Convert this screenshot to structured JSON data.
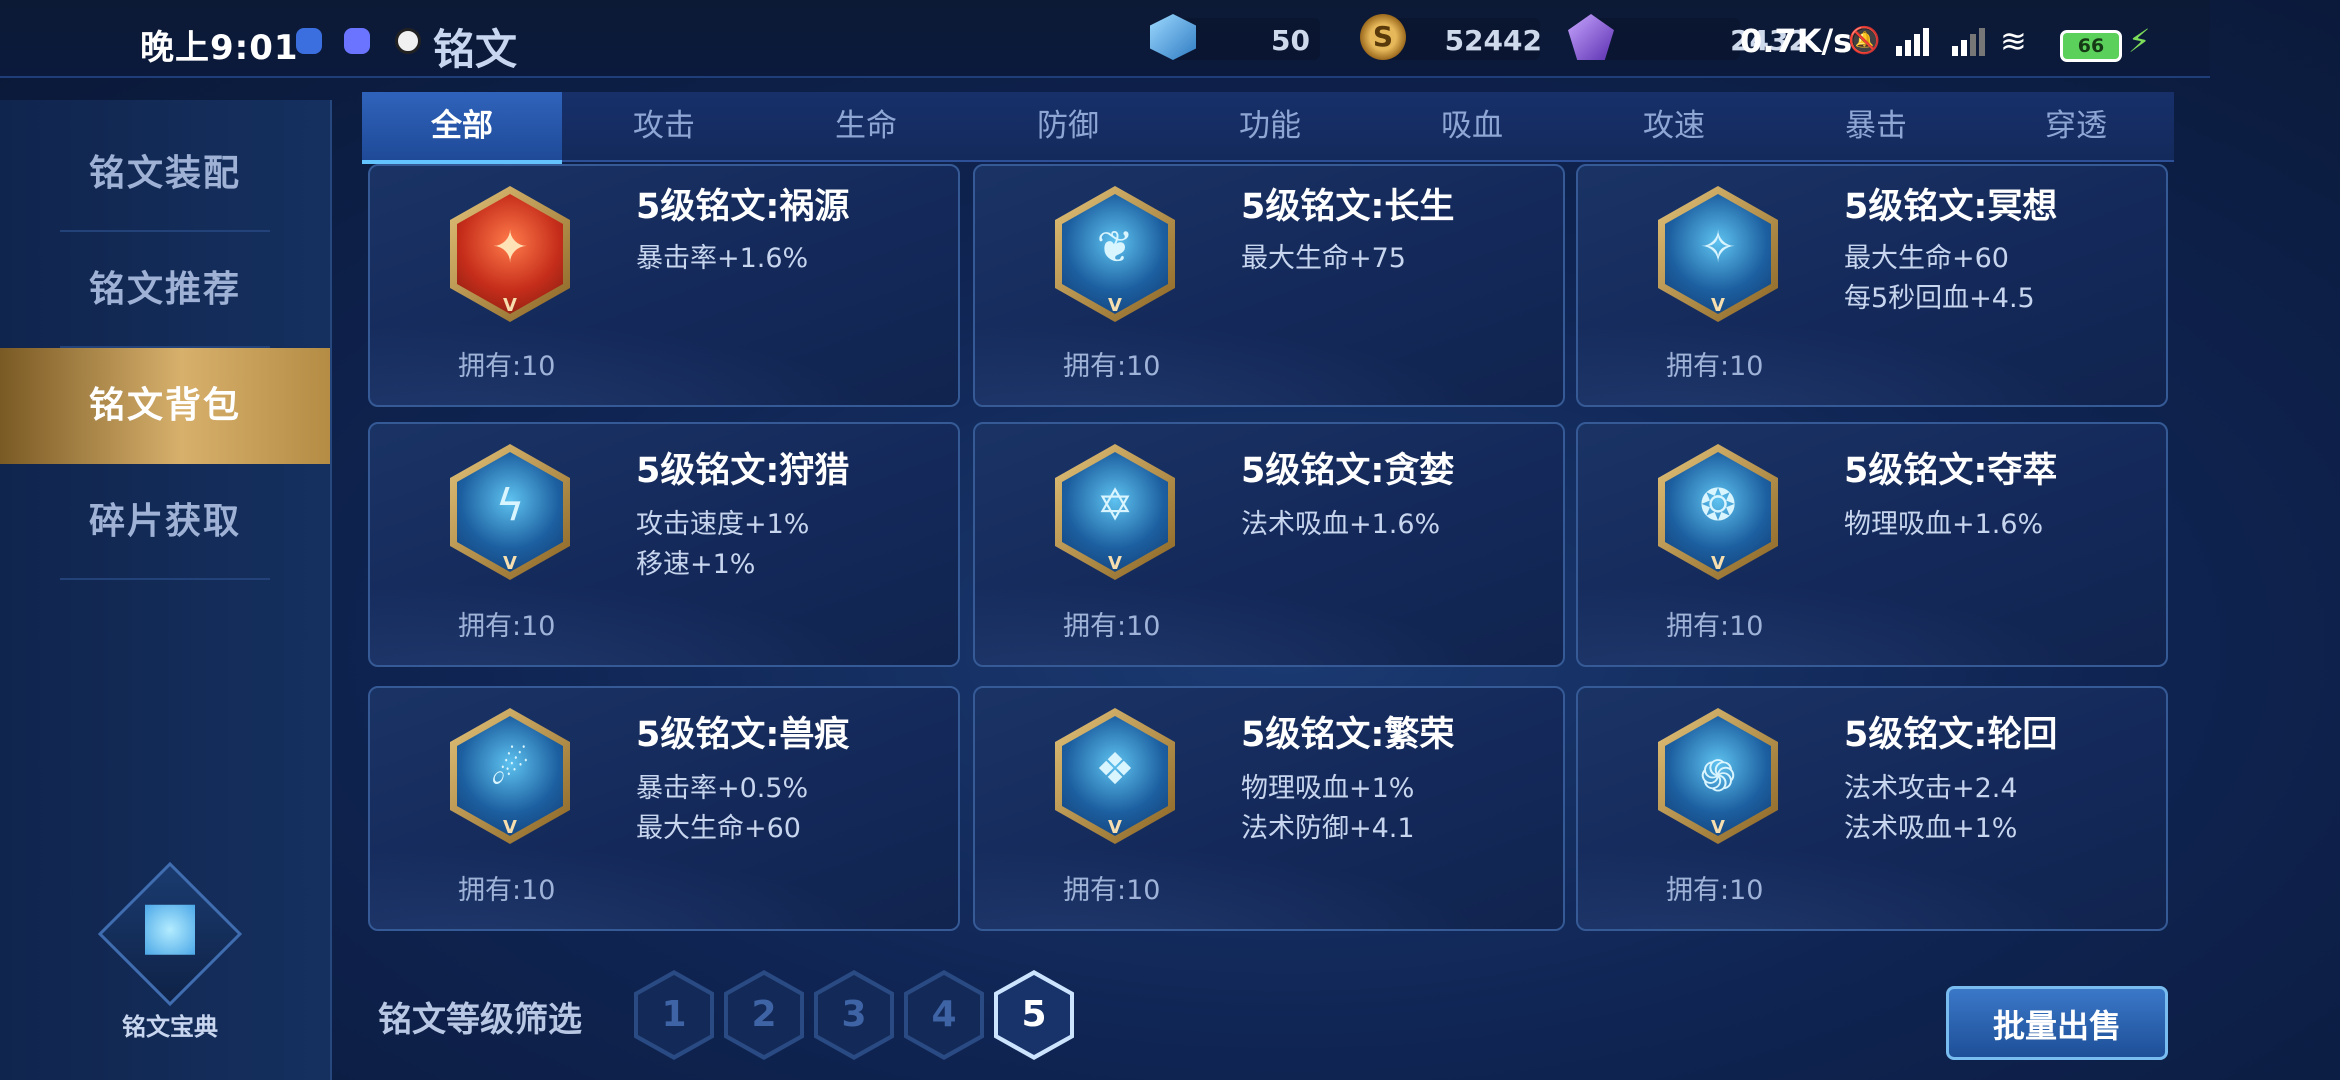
{
  "status_bar": {
    "time": "晚上9:01",
    "net_speed": "0.7K/s",
    "battery": "66"
  },
  "header": {
    "title": "铭文",
    "resources": [
      {
        "icon": "crystal-icon",
        "value": "50"
      },
      {
        "icon": "gold-coin-icon",
        "value": "52442"
      },
      {
        "icon": "diamond-icon",
        "value": "2432"
      }
    ]
  },
  "sidebar": {
    "items": [
      {
        "label": "铭文装配",
        "active": false
      },
      {
        "label": "铭文推荐",
        "active": false
      },
      {
        "label": "铭文背包",
        "active": true
      },
      {
        "label": "碎片获取",
        "active": false
      }
    ],
    "codex_label": "铭文宝典"
  },
  "tabs": [
    {
      "label": "全部",
      "active": true
    },
    {
      "label": "攻击"
    },
    {
      "label": "生命"
    },
    {
      "label": "防御"
    },
    {
      "label": "功能"
    },
    {
      "label": "吸血"
    },
    {
      "label": "攻速"
    },
    {
      "label": "暴击"
    },
    {
      "label": "穿透"
    }
  ],
  "runes": [
    {
      "title": "5级铭文:祸源",
      "stats": [
        "暴击率+1.6%"
      ],
      "owned": "拥有:10",
      "color": "red"
    },
    {
      "title": "5级铭文:长生",
      "stats": [
        "最大生命+75"
      ],
      "owned": "拥有:10",
      "color": "blue"
    },
    {
      "title": "5级铭文:冥想",
      "stats": [
        "最大生命+60",
        "每5秒回血+4.5"
      ],
      "owned": "拥有:10",
      "color": "blue"
    },
    {
      "title": "5级铭文:狩猎",
      "stats": [
        "攻击速度+1%",
        "移速+1%"
      ],
      "owned": "拥有:10",
      "color": "blue"
    },
    {
      "title": "5级铭文:贪婪",
      "stats": [
        "法术吸血+1.6%"
      ],
      "owned": "拥有:10",
      "color": "blue"
    },
    {
      "title": "5级铭文:夺萃",
      "stats": [
        "物理吸血+1.6%"
      ],
      "owned": "拥有:10",
      "color": "blue"
    },
    {
      "title": "5级铭文:兽痕",
      "stats": [
        "暴击率+0.5%",
        "最大生命+60"
      ],
      "owned": "拥有:10",
      "color": "blue"
    },
    {
      "title": "5级铭文:繁荣",
      "stats": [
        "物理吸血+1%",
        "法术防御+4.1"
      ],
      "owned": "拥有:10",
      "color": "blue"
    },
    {
      "title": "5级铭文:轮回",
      "stats": [
        "法术攻击+2.4",
        "法术吸血+1%"
      ],
      "owned": "拥有:10",
      "color": "blue"
    }
  ],
  "rune_level_mark": "V",
  "filter": {
    "label": "铭文等级筛选",
    "levels": [
      "1",
      "2",
      "3",
      "4",
      "5"
    ],
    "selected": "5"
  },
  "bulk_sell_label": "批量出售"
}
